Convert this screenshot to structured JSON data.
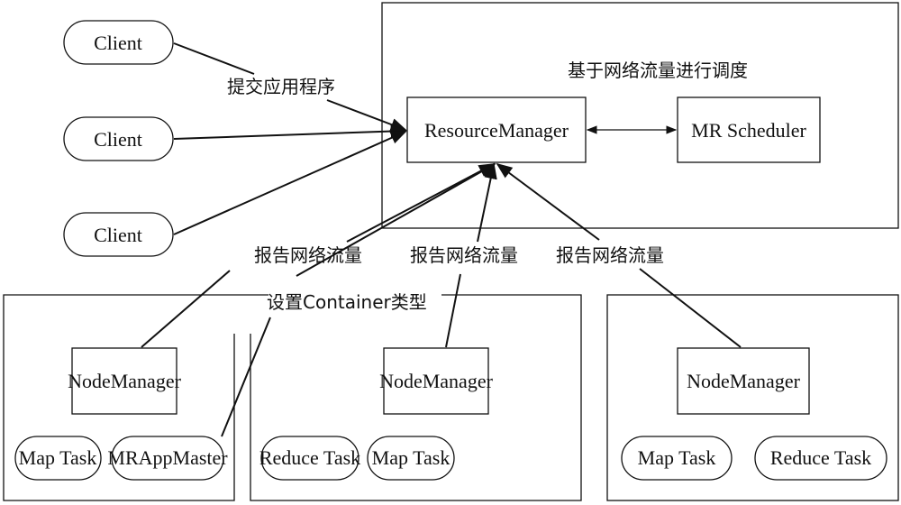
{
  "diagram": {
    "clients": [
      "Client",
      "Client",
      "Client"
    ],
    "submit_label": "提交应用程序",
    "rm_group_label": "基于网络流量进行调度",
    "resource_manager": "ResourceManager",
    "scheduler": "MR Scheduler",
    "report_labels": [
      "报告网络流量",
      "报告网络流量",
      "报告网络流量"
    ],
    "container_label": "设置Container类型",
    "nodes": [
      {
        "manager": "NodeManager",
        "tasks": [
          "Map Task",
          "MRAppMaster"
        ]
      },
      {
        "manager": "NodeManager",
        "tasks": [
          "Reduce Task",
          "Map Task"
        ]
      },
      {
        "manager": "NodeManager",
        "tasks": [
          "Map Task",
          "Reduce Task"
        ]
      }
    ]
  }
}
